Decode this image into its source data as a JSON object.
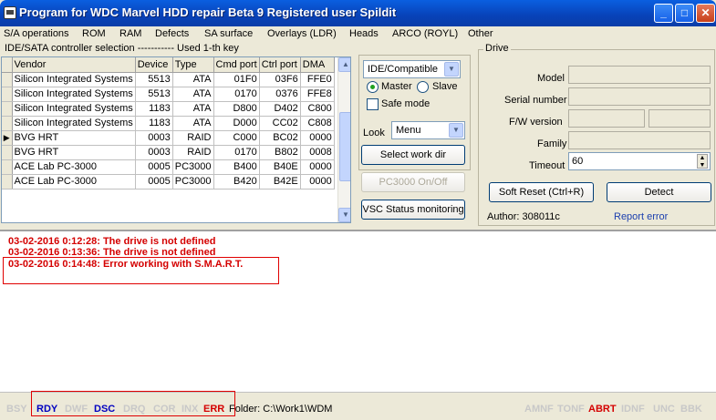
{
  "window": {
    "title": "Program for WDC Marvel HDD repair Beta 9 Registered user Spildit",
    "min_glyph": "_",
    "max_glyph": "□",
    "close_glyph": "✕"
  },
  "menu": [
    "S/A operations",
    "ROM",
    "RAM",
    "Defects",
    "SA surface",
    "Overlays (LDR)",
    "Heads",
    "ARCO (ROYL)",
    "Other"
  ],
  "controller_group": {
    "label": "IDE/SATA controller selection ----------- Used 1-th key",
    "columns": [
      "Vendor",
      "Device",
      "Type",
      "Cmd port",
      "Ctrl port",
      "DMA"
    ],
    "rows": [
      {
        "indicator": "",
        "vendor": "Silicon Integrated Systems",
        "device": "5513",
        "type": "ATA",
        "cmd": "01F0",
        "ctrl": "03F6",
        "dma": "FFE0"
      },
      {
        "indicator": "",
        "vendor": "Silicon Integrated Systems",
        "device": "5513",
        "type": "ATA",
        "cmd": "0170",
        "ctrl": "0376",
        "dma": "FFE8"
      },
      {
        "indicator": "",
        "vendor": "Silicon Integrated Systems",
        "device": "1183",
        "type": "ATA",
        "cmd": "D800",
        "ctrl": "D402",
        "dma": "C800"
      },
      {
        "indicator": "",
        "vendor": "Silicon Integrated Systems",
        "device": "1183",
        "type": "ATA",
        "cmd": "D000",
        "ctrl": "CC02",
        "dma": "C808"
      },
      {
        "indicator": "▶",
        "vendor": "BVG HRT",
        "device": "0003",
        "type": "RAID",
        "cmd": "C000",
        "ctrl": "BC02",
        "dma": "0000"
      },
      {
        "indicator": "",
        "vendor": "BVG HRT",
        "device": "0003",
        "type": "RAID",
        "cmd": "0170",
        "ctrl": "B802",
        "dma": "0008"
      },
      {
        "indicator": "",
        "vendor": "ACE Lab PC-3000",
        "device": "0005",
        "type": "PC3000",
        "cmd": "B400",
        "ctrl": "B40E",
        "dma": "0000"
      },
      {
        "indicator": "",
        "vendor": "ACE Lab PC-3000",
        "device": "0005",
        "type": "PC3000",
        "cmd": "B420",
        "ctrl": "B42E",
        "dma": "0000"
      }
    ]
  },
  "middle_panel": {
    "mode_select": "IDE/Compatible",
    "master_label": "Master",
    "slave_label": "Slave",
    "safe_mode_label": "Safe mode",
    "look_label": "Look",
    "look_select": "Menu",
    "select_work_dir": "Select work dir",
    "pc3000_toggle": "PC3000 On/Off",
    "vsc_status": "VSC Status monitoring"
  },
  "drive": {
    "label": "Drive",
    "model_label": "Model",
    "serial_label": "Serial number",
    "fw_label": "F/W version",
    "family_label": "Family",
    "timeout_label": "Timeout",
    "timeout_value": "60",
    "soft_reset": "Soft Reset (Ctrl+R)",
    "detect": "Detect",
    "author": "Author: 308011c",
    "report_error": "Report error"
  },
  "log": [
    "03-02-2016 0:12:28: The drive is not defined",
    "03-02-2016 0:13:36: The drive is not defined",
    "03-02-2016 0:14:48: Error working with S.M.A.R.T."
  ],
  "status": {
    "left_flags": [
      "BSY",
      "RDY",
      "DWF",
      "DSC",
      "DRQ",
      "COR",
      "INX",
      "ERR"
    ],
    "folder": "Folder: C:\\Work1\\WDM",
    "right_flags": [
      "AMNF",
      "TONF",
      "ABRT",
      "IDNF",
      "UNC",
      "BBK"
    ]
  },
  "colors": {
    "log_text": "#d40000",
    "flag_active_blue": "#0000c0",
    "flag_active_red": "#d40000",
    "flag_inactive": "#c8c8c8",
    "link": "#1b3fae"
  }
}
